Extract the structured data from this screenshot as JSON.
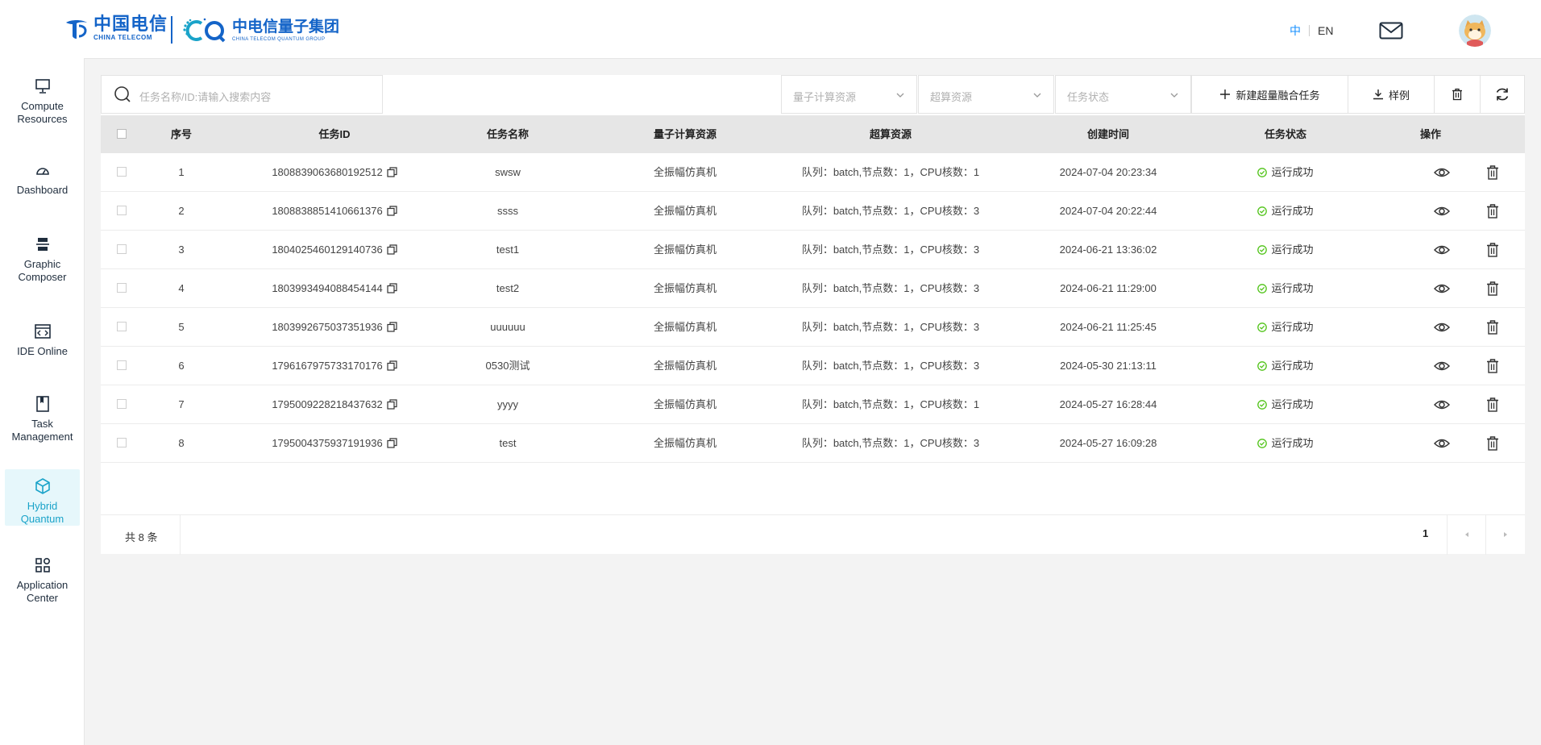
{
  "header": {
    "logo_telecom_cn": "中国电信",
    "logo_telecom_en": "CHINA TELECOM",
    "logo_quantum_cn": "中电信量子集团",
    "logo_quantum_en": "CHINA TELECOM QUANTUM GROUP",
    "lang_zh": "中",
    "lang_en": "EN",
    "mail_icon": "mail-icon",
    "avatar_icon": "user-avatar"
  },
  "sidebar": {
    "items": [
      {
        "label": "Compute Resources",
        "icon": "monitor-icon"
      },
      {
        "label": "Dashboard",
        "icon": "cloud-icon"
      },
      {
        "label": "Graphic Composer",
        "icon": "circuit-icon"
      },
      {
        "label": "IDE Online",
        "icon": "code-window-icon"
      },
      {
        "label": "Task Management",
        "icon": "book-icon"
      },
      {
        "label": "Hybrid Quantum",
        "icon": "cube-icon",
        "active": true
      },
      {
        "label": "Application Center",
        "icon": "apps-grid-icon"
      }
    ]
  },
  "toolbar": {
    "search_placeholder": "任务名称/ID:请输入搜索内容",
    "filter_quantum": "量子计算资源",
    "filter_super": "超算资源",
    "filter_status": "任务状态",
    "new_task_label": "新建超量融合任务",
    "example_label": "样例"
  },
  "table": {
    "columns": [
      "序号",
      "任务ID",
      "任务名称",
      "量子计算资源",
      "超算资源",
      "创建时间",
      "任务状态",
      "操作"
    ],
    "rows": [
      {
        "index": "1",
        "id": "1808839063680192512",
        "name": "swsw",
        "quantum": "全振幅仿真机",
        "super": "队列：batch,节点数：1，CPU核数：1",
        "created": "2024-07-04 20:23:34",
        "status": "运行成功"
      },
      {
        "index": "2",
        "id": "1808838851410661376",
        "name": "ssss",
        "quantum": "全振幅仿真机",
        "super": "队列：batch,节点数：1，CPU核数：3",
        "created": "2024-07-04 20:22:44",
        "status": "运行成功"
      },
      {
        "index": "3",
        "id": "1804025460129140736",
        "name": "test1",
        "quantum": "全振幅仿真机",
        "super": "队列：batch,节点数：1，CPU核数：3",
        "created": "2024-06-21 13:36:02",
        "status": "运行成功"
      },
      {
        "index": "4",
        "id": "1803993494088454144",
        "name": "test2",
        "quantum": "全振幅仿真机",
        "super": "队列：batch,节点数：1，CPU核数：3",
        "created": "2024-06-21 11:29:00",
        "status": "运行成功"
      },
      {
        "index": "5",
        "id": "1803992675037351936",
        "name": "uuuuuu",
        "quantum": "全振幅仿真机",
        "super": "队列：batch,节点数：1，CPU核数：3",
        "created": "2024-06-21 11:25:45",
        "status": "运行成功"
      },
      {
        "index": "6",
        "id": "1796167975733170176",
        "name": "0530测试",
        "quantum": "全振幅仿真机",
        "super": "队列：batch,节点数：1，CPU核数：3",
        "created": "2024-05-30 21:13:11",
        "status": "运行成功"
      },
      {
        "index": "7",
        "id": "1795009228218437632",
        "name": "yyyy",
        "quantum": "全振幅仿真机",
        "super": "队列：batch,节点数：1，CPU核数：1",
        "created": "2024-05-27 16:28:44",
        "status": "运行成功"
      },
      {
        "index": "8",
        "id": "1795004375937191936",
        "name": "test",
        "quantum": "全振幅仿真机",
        "super": "队列：batch,节点数：1，CPU核数：3",
        "created": "2024-05-27 16:09:28",
        "status": "运行成功"
      }
    ]
  },
  "pagination": {
    "total_text": "共 8 条",
    "current_page": "1"
  },
  "colors": {
    "brand": "#1464c8",
    "accent": "#1aa3c9",
    "success": "#52c41a"
  }
}
